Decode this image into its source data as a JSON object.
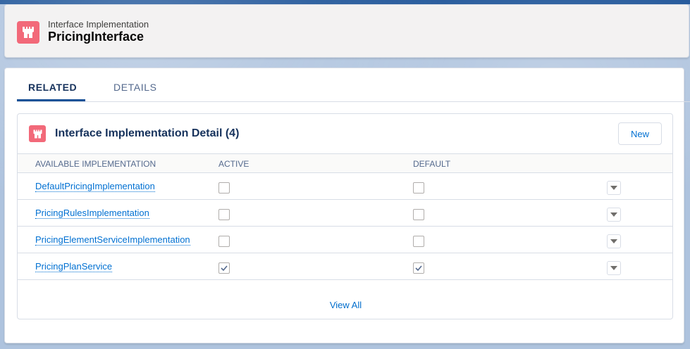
{
  "header": {
    "subtitle": "Interface Implementation",
    "title": "PricingInterface",
    "icon": "castle-icon"
  },
  "tabs": [
    {
      "label": "RELATED",
      "active": true
    },
    {
      "label": "DETAILS",
      "active": false
    }
  ],
  "related_list": {
    "title": "Interface Implementation Detail (4)",
    "icon": "castle-icon",
    "new_label": "New",
    "columns": [
      "AVAILABLE IMPLEMENTATION",
      "ACTIVE",
      "DEFAULT"
    ],
    "rows": [
      {
        "name": "DefaultPricingImplementation",
        "active": false,
        "default": false
      },
      {
        "name": "PricingRulesImplementation",
        "active": false,
        "default": false
      },
      {
        "name": "PricingElementServiceImplementation",
        "active": false,
        "default": false
      },
      {
        "name": "PricingPlanService",
        "active": true,
        "default": true
      }
    ],
    "view_all": "View All"
  },
  "colors": {
    "accent": "#0070d2",
    "icon_bg": "#f26979",
    "brand": "#1b5297"
  }
}
